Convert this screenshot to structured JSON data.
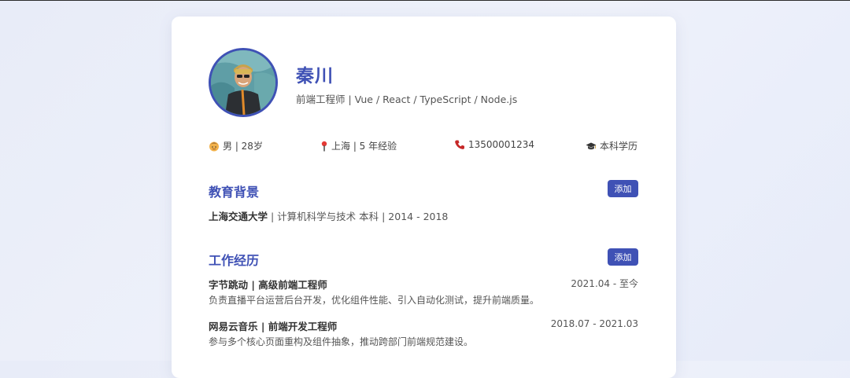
{
  "profile": {
    "name": "秦川",
    "title": "前端工程师 | Vue / React / TypeScript / Node.js",
    "avatar_alt": "头像"
  },
  "info": {
    "gender_age": "男 | 28岁",
    "location_exp": "上海 | 5 年经验",
    "phone": "13500001234",
    "degree": "本科学历",
    "icons": [
      "person-icon",
      "location-pin-icon",
      "phone-icon",
      "graduation-cap-icon"
    ]
  },
  "education": {
    "section_title": "教育背景",
    "add_label": "添加",
    "school": "上海交通大学",
    "detail": " | 计算机科学与技术 本科 | 2014 - 2018"
  },
  "work": {
    "section_title": "工作经历",
    "add_label": "添加",
    "items": [
      {
        "heading": "字节跳动 | 高级前端工程师",
        "date": "2021.04 - 至今",
        "desc": "负责直播平台运营后台开发，优化组件性能、引入自动化测试，提升前端质量。"
      },
      {
        "heading": "网易云音乐 | 前端开发工程师",
        "date": "2018.07 - 2021.03",
        "desc": "参与多个核心页面重构及组件抽象，推动跨部门前端规范建设。"
      }
    ]
  },
  "colors": {
    "accent": "#3f51b5",
    "background": "#eef1fa",
    "card": "#ffffff"
  }
}
